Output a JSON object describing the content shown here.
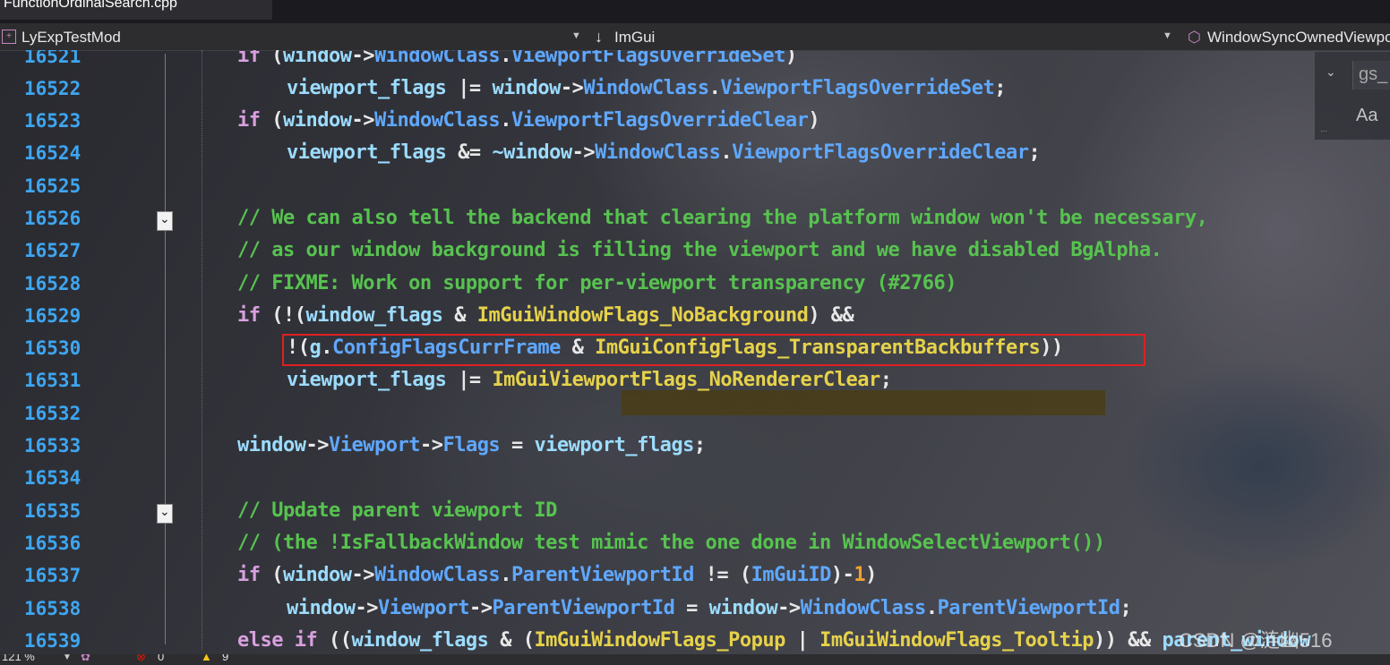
{
  "file_tab": {
    "name": "FunctionOrdinalSearch.cpp"
  },
  "navbar": {
    "project": "LyExpTestMod",
    "scope": "ImGui",
    "member": "WindowSyncOwnedViewport"
  },
  "find_widget": {
    "value": "gs_",
    "match_case_label": "Aa"
  },
  "code_lines": [
    {
      "num": "16521"
    },
    {
      "num": "16522"
    },
    {
      "num": "16523"
    },
    {
      "num": "16524"
    },
    {
      "num": "16525"
    },
    {
      "num": "16526"
    },
    {
      "num": "16527"
    },
    {
      "num": "16528"
    },
    {
      "num": "16529"
    },
    {
      "num": "16530"
    },
    {
      "num": "16531"
    },
    {
      "num": "16532"
    },
    {
      "num": "16533"
    },
    {
      "num": "16534"
    },
    {
      "num": "16535"
    },
    {
      "num": "16536"
    },
    {
      "num": "16537"
    },
    {
      "num": "16538"
    },
    {
      "num": "16539"
    }
  ],
  "tokens": {
    "if": "if",
    "else": "else",
    "window": "window",
    "arrow": "->",
    "dot": ".",
    "WindowClass": "WindowClass",
    "ViewportFlagsOverrideSet": "ViewportFlagsOverrideSet",
    "ViewportFlagsOverrideClear": "ViewportFlagsOverrideClear",
    "viewport_flags": "viewport_flags",
    "or_eq": "|=",
    "and_eq": "&=",
    "not_arrow": "~window",
    "comment_1": "// We can also tell the backend that clearing the platform window won't be necessary,",
    "comment_2": "// as our window background is filling the viewport and we have disabled BgAlpha.",
    "comment_3": "// FIXME: Work on support for per-viewport transparency (#2766)",
    "window_flags": "window_flags",
    "NoBackground": "ImGuiWindowFlags_NoBackground",
    "g": "g",
    "ConfigFlagsCurrFrame": "ConfigFlagsCurrFrame",
    "TransparentBackbuffers": "ImGuiConfigFlags_TransparentBackbuffers",
    "NoRendererClear": "ImGuiViewportFlags_NoRendererClear",
    "Viewport": "Viewport",
    "Flags": "Flags",
    "comment_4": "// Update parent viewport ID",
    "comment_5": "// (the !IsFallbackWindow test mimic the one done in WindowSelectViewport())",
    "ParentViewportId": "ParentViewportId",
    "ImGuiID": "ImGuiID",
    "one": "1",
    "Popup": "ImGuiWindowFlags_Popup",
    "Tooltip": "ImGuiWindowFlags_Tooltip",
    "parent_window": "parent_window"
  },
  "status": {
    "zoom": "121 %",
    "errors": "0",
    "warnings": "9"
  },
  "watermark": "CSDN @涟幽516"
}
